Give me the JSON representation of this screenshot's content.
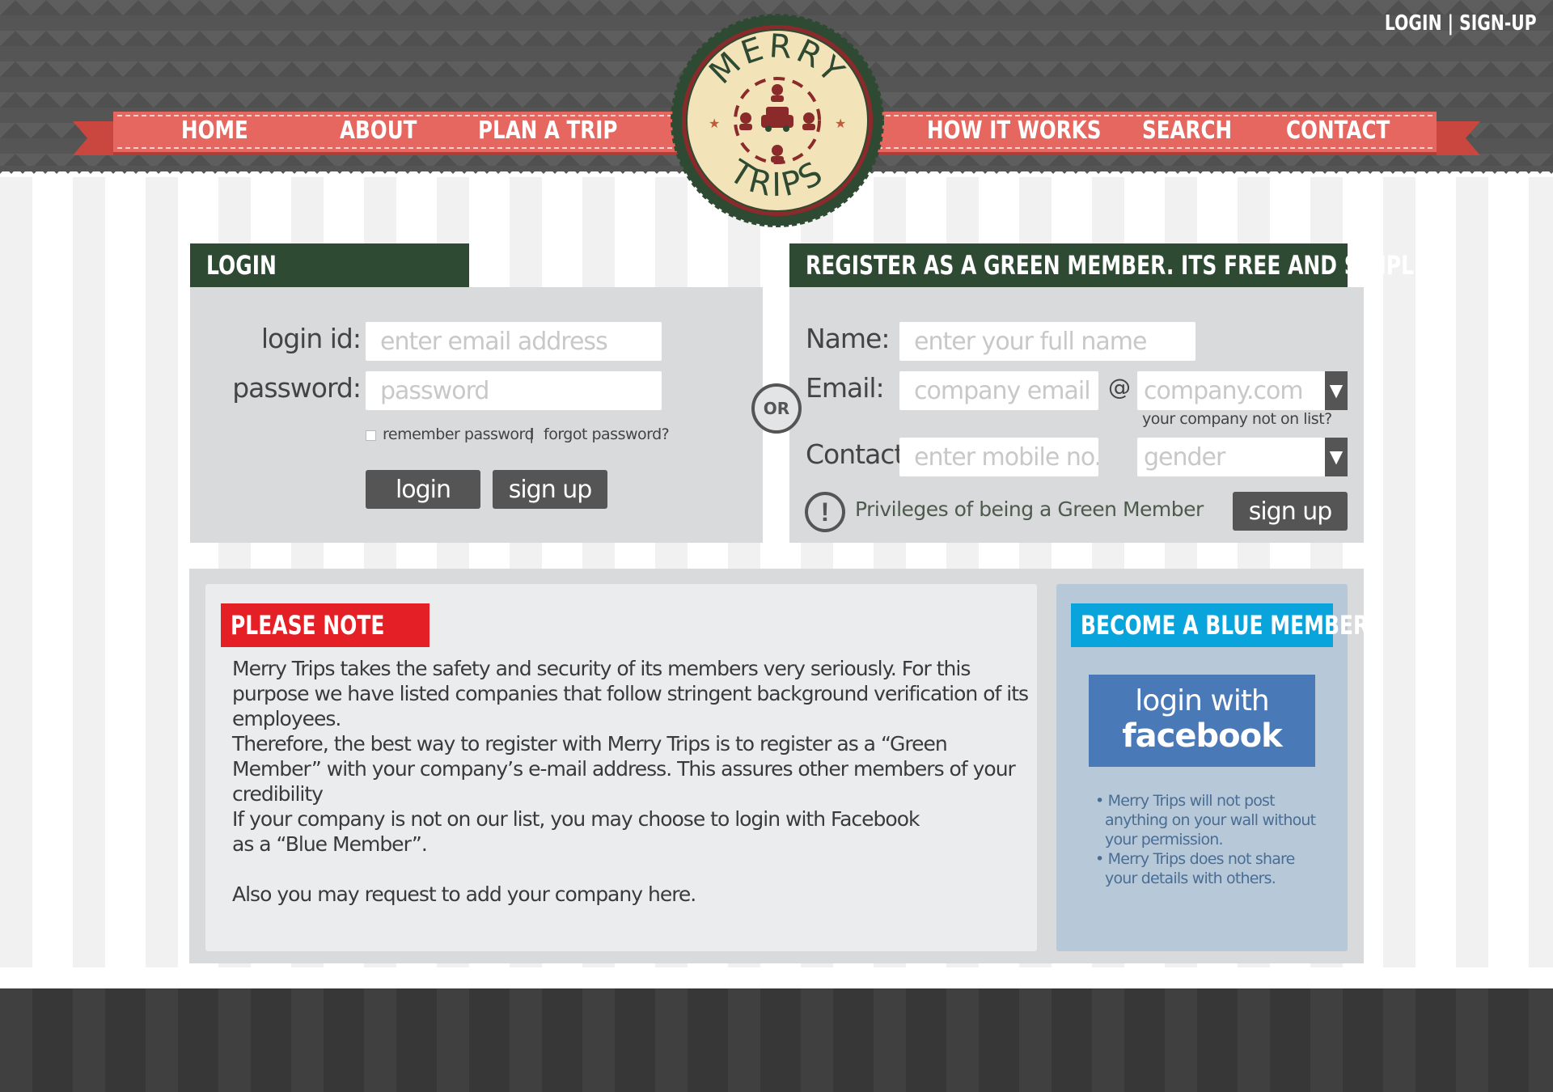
{
  "header": {
    "top_links": {
      "login": "LOGIN",
      "separator": " | ",
      "signup": "SIGN-UP"
    },
    "nav": {
      "home": "HOME",
      "about": "ABOUT",
      "plan_a_trip": "PLAN A TRIP",
      "how_it_works": "HOW IT WORKS",
      "search": "SEARCH",
      "contact": "CONTACT"
    },
    "logo": {
      "line1": "MERRY",
      "line2": "TRIPS"
    }
  },
  "login": {
    "title": "LOGIN",
    "login_id_label": "login id:",
    "login_id_placeholder": "enter email address",
    "password_label": "password:",
    "password_placeholder": "password",
    "remember_label": "remember password",
    "separator": "|",
    "forgot_label": "forgot password?",
    "login_button": "login",
    "signup_button": "sign up"
  },
  "or_label": "OR",
  "register": {
    "title": "REGISTER AS A GREEN MEMBER. ITS FREE AND SIMPLE!",
    "name_label": "Name:",
    "name_placeholder": "enter your full name",
    "email_label": "Email:",
    "email_placeholder": "company email",
    "at_sign": "@",
    "domain_placeholder": "company.com",
    "company_not_listed": "your company not on list?",
    "contact_label": "Contact:",
    "contact_placeholder": "enter mobile no.",
    "gender_placeholder": "gender",
    "privileges_text": "Privileges of being a Green Member",
    "signup_button": "sign up"
  },
  "note": {
    "title": "PLEASE NOTE",
    "paragraphs": [
      "Merry Trips takes the safety and security of its members very seriously. For this purpose we have listed companies that follow stringent background verification of its employees.",
      "Therefore, the best way to register with Merry Trips is to register as a “Green Member” with your company’s e-mail address. This assures other members of your credibility",
      "If your company is not on our list, you may choose to login with Facebook as a “Blue Member”.",
      "Also you may request to add your company here."
    ]
  },
  "blue_member": {
    "title": "BECOME A BLUE MEMBER",
    "fb_line1": "login with",
    "fb_line2": "facebook",
    "notes": [
      "• Merry Trips will not post anything on your wall without your permission.",
      "• Merry Trips does not share your details with others."
    ]
  },
  "colors": {
    "header_bg": "#555556",
    "ribbon": "#e5675f",
    "green_header": "#2e4a33",
    "panel_bg": "#d9dadb",
    "note_red": "#e41f26",
    "blue_tag": "#0aa4dc",
    "facebook_blue": "#4a79b7",
    "button_gray": "#555556"
  },
  "icons": {
    "dropdown": "chevron-down-icon",
    "privileges": "exclamation-circle-icon"
  }
}
